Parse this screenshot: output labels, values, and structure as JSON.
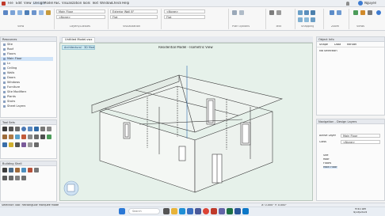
{
  "menu": [
    "File",
    "Edit",
    "View",
    "Design",
    "Model",
    "AEC",
    "Visualization",
    "Tools",
    "Text",
    "Window",
    "Check",
    "Help"
  ],
  "user": "Nguyen",
  "ribbon": {
    "layer_value": "Main Floor",
    "class_value": "<None>",
    "wall_style": "Exterior Wall 8\"",
    "view_value": "Flat",
    "groups": [
      "View",
      "Layers/Classes",
      "Visualization",
      "Plan Options",
      "Text",
      "Snapping",
      "Zoom",
      "Views"
    ]
  },
  "left_panel": {
    "title": "Resources",
    "items": [
      "Site",
      "Roof",
      "Floors",
      "Main Floor",
      "Lv",
      "Ceiling",
      "Walls",
      "Doors",
      "Windows",
      "Furniture",
      "Site Modifiers",
      "Plants",
      "Stairs",
      "Sheet Layers"
    ],
    "selected_index": 3
  },
  "tool_panel": {
    "title": "Tool Sets"
  },
  "snap_panel": {
    "title": "Building Shell"
  },
  "view": {
    "tab_label": "Untitled Model.vwx",
    "tag_label": "Architectural · 3D Model",
    "drawing_title": "Residential Model - Isometric View"
  },
  "props_panel": {
    "title": "Object Info",
    "tabs": [
      "Shape",
      "Data",
      "Render"
    ],
    "selection": "No Selection"
  },
  "nav_panel": {
    "title": "Navigation - Design Layers",
    "rows": [
      {
        "label": "Active Layer",
        "value": "Main Floor"
      },
      {
        "label": "Class",
        "value": "<None>"
      }
    ],
    "list": [
      "Site",
      "Roof",
      "Floors",
      "Main Floor"
    ]
  },
  "status": {
    "text": "Selection Tool: Rectangular Marquee Mode",
    "coord": "X: 0.000\"   Y: 0.000\""
  },
  "taskbar": {
    "search_placeholder": "Search",
    "time": "9:40 AM",
    "date": "4/18/2024"
  },
  "colors": {
    "viewport_bg": "#e6f1ea",
    "accent": "#2b6cb0",
    "selection": "#cfe3f8"
  }
}
